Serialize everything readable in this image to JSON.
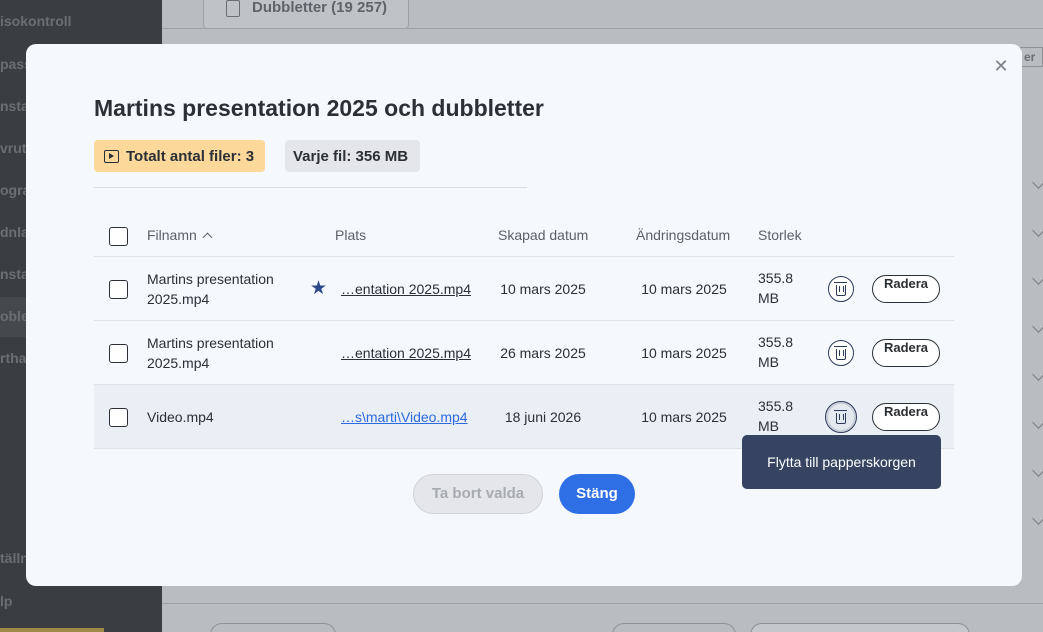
{
  "background": {
    "tab_label": "Dubbletter (19 257)",
    "filter_tag": "er",
    "sidebar_items": [
      {
        "label": "isokontroll"
      },
      {
        "label": "pass"
      },
      {
        "label": "nsta"
      },
      {
        "label": "vrut"
      },
      {
        "label": "ogra"
      },
      {
        "label": "dnla"
      },
      {
        "label": "nsta"
      },
      {
        "label": "oble"
      },
      {
        "label": "rtha"
      },
      {
        "label": "tälln"
      },
      {
        "label": "lp"
      }
    ]
  },
  "modal": {
    "title": "Martins presentation 2025 och dubbletter",
    "badges": {
      "total_files": "Totalt antal filer: 3",
      "each_file": "Varje fil: 356 MB"
    },
    "table": {
      "headers": {
        "filename": "Filnamn",
        "location": "Plats",
        "created": "Skapad datum",
        "modified": "Ändringsdatum",
        "size": "Storlek"
      },
      "rows": [
        {
          "filename": "Martins presentation 2025.mp4",
          "original": true,
          "path": "…entation 2025.mp4",
          "created": "10 mars 2025",
          "modified": "10 mars 2025",
          "size": "355.8 MB",
          "delete_label": "Radera"
        },
        {
          "filename": "Martins presentation 2025.mp4",
          "original": false,
          "path": "…entation 2025.mp4",
          "created": "26 mars 2025",
          "modified": "10 mars 2025",
          "size": "355.8 MB",
          "delete_label": "Radera"
        },
        {
          "filename": "Video.mp4",
          "original": false,
          "path": "…s\\marti\\Video.mp4",
          "created": "18 juni 2026",
          "modified": "10 mars 2025",
          "size": "355.8 MB",
          "delete_label": "Radera"
        }
      ]
    },
    "tooltip": "Flytta till papperskorgen",
    "buttons": {
      "remove_selected": "Ta bort valda",
      "close": "Stäng"
    }
  },
  "colors": {
    "primary": "#2f6fe6",
    "badge_total": "#fcd89a",
    "tooltip_bg": "#364462",
    "star": "#2f4a8a"
  }
}
